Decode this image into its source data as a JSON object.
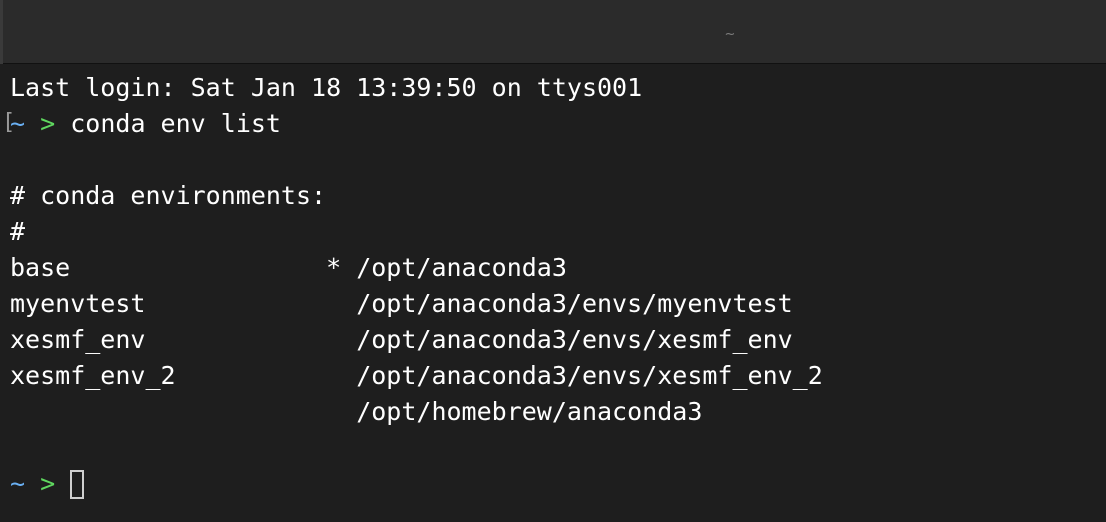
{
  "window": {
    "title": "~"
  },
  "terminal": {
    "last_login": "Last login: Sat Jan 18 13:39:50 on ttys001",
    "prompt_dir": "~",
    "prompt_symbol": ">",
    "prompt_bracket": "[",
    "command": "conda env list",
    "header": "# conda environments:",
    "hash_line": "#",
    "environments": [
      {
        "name": "base",
        "active_marker": "*",
        "path": "/opt/anaconda3"
      },
      {
        "name": "myenvtest",
        "active_marker": "",
        "path": "/opt/anaconda3/envs/myenvtest"
      },
      {
        "name": "xesmf_env",
        "active_marker": "",
        "path": "/opt/anaconda3/envs/xesmf_env"
      },
      {
        "name": "xesmf_env_2",
        "active_marker": "",
        "path": "/opt/anaconda3/envs/xesmf_env_2"
      },
      {
        "name": "",
        "active_marker": "",
        "path": "/opt/homebrew/anaconda3"
      }
    ],
    "colors": {
      "background": "#1e1e1e",
      "text": "#ffffff",
      "prompt_dir": "#6ab0f3",
      "prompt_symbol": "#5fd75f"
    }
  }
}
